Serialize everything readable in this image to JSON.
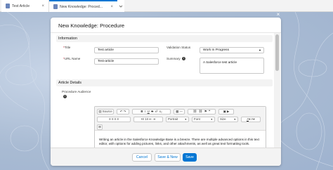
{
  "tabs": [
    {
      "label": "Test Article"
    },
    {
      "label": "New Knowledge: Proced..."
    }
  ],
  "modal": {
    "title": "New Knowledge: Procedure"
  },
  "information": {
    "heading": "Information",
    "title_label": "Title",
    "title_value": "Test article",
    "url_label": "URL Name",
    "url_value": "Test-article",
    "status_label": "Validation Status",
    "status_value": "Work In Progress",
    "summary_label": "Summary",
    "summary_value": "A Salesforce test article"
  },
  "details": {
    "heading": "Article Details",
    "audience_label": "Procedure Audience"
  },
  "editor": {
    "source_label": "Source",
    "font_dd": "Portrait",
    "size_dd": "Font",
    "style_dd": "Size",
    "content": "Writing an article in the Salesforce Knowledge Base is a breeze. There are multiple advanced options in this text editor, with options for adding pictures, links, and other attachments, as well as great text formatting tools."
  },
  "footer": {
    "cancel": "Cancel",
    "save_new": "Save & New",
    "save": "Save"
  },
  "colors": {
    "brand": "#0176d3",
    "required": "#ba0517"
  }
}
